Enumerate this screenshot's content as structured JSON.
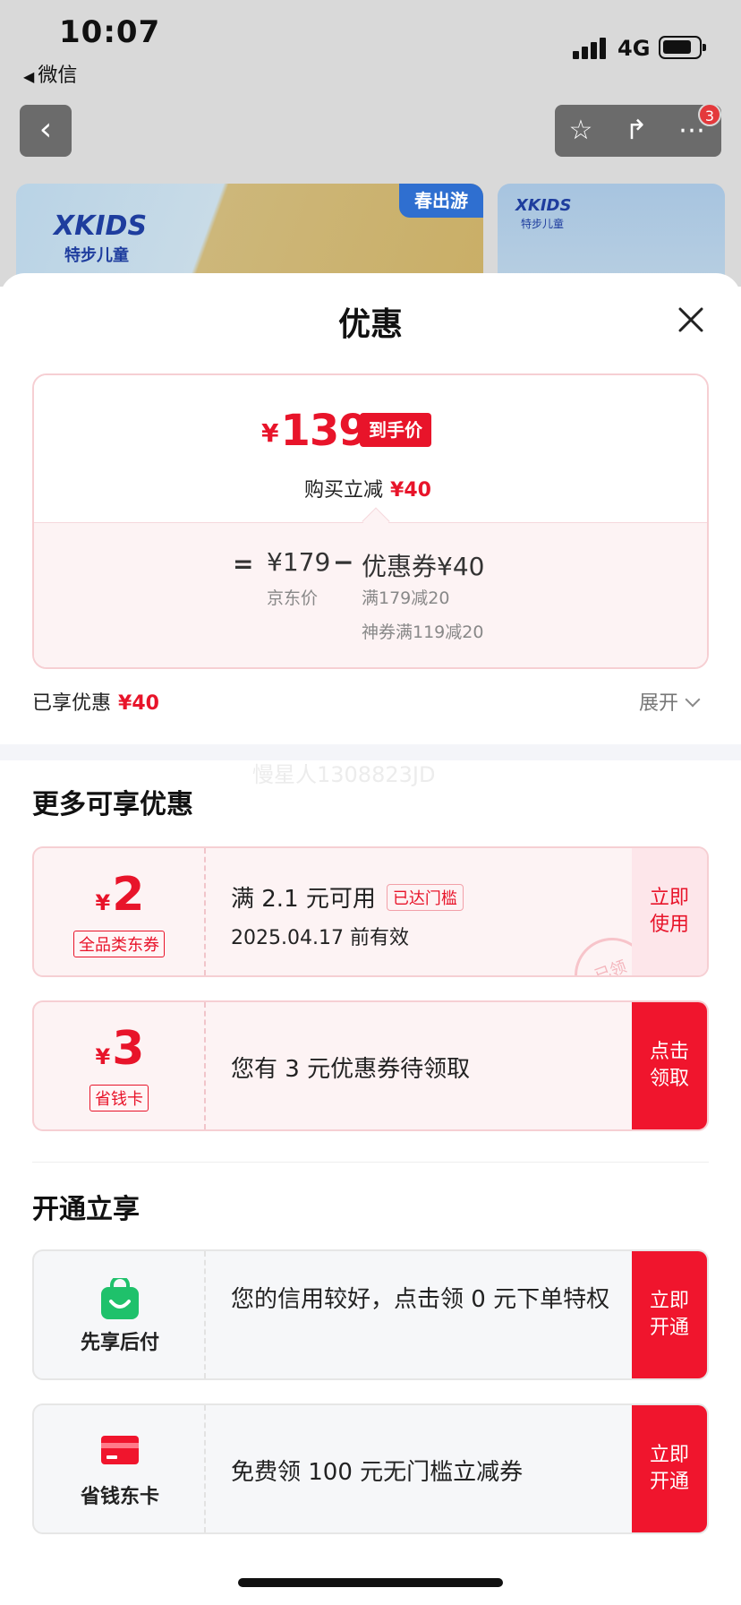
{
  "status_bar": {
    "time": "10:07",
    "back_app": "微信",
    "network": "4G"
  },
  "nav": {
    "badge": "3"
  },
  "banners": {
    "logo": "XKIDS",
    "logo_sub": "特步儿童",
    "tag": "春出游"
  },
  "sheet": {
    "title": "优惠"
  },
  "price_card": {
    "currency": "¥",
    "final_price": "139",
    "final_tag": "到手价",
    "buy_reduce_label": "购买立减",
    "buy_reduce_value": "¥40",
    "equals": "=",
    "jd_price": "¥179",
    "jd_price_label": "京东价",
    "minus": "−",
    "coupon_total": "优惠券¥40",
    "coupon_lines": [
      "满179减20",
      "神券满119减20"
    ]
  },
  "enjoyed": {
    "label": "已享优惠",
    "value": "¥40",
    "expand": "展开"
  },
  "watermark": "慢星人1308823JD",
  "more_section": {
    "title": "更多可享优惠",
    "coupons": [
      {
        "currency": "¥",
        "amount": "2",
        "tag": "全品类东券",
        "line1": "满 2.1 元可用",
        "badge": "已达门槛",
        "line2": "2025.04.17 前有效",
        "action": "立即使用",
        "stamp": "已领"
      },
      {
        "currency": "¥",
        "amount": "3",
        "tag": "省钱卡",
        "line1": "您有 3 元优惠券待领取",
        "action": "点击领取"
      }
    ]
  },
  "open_section": {
    "title": "开通立享",
    "items": [
      {
        "icon": "green-bag-icon",
        "label": "先享后付",
        "text": "您的信用较好，点击领 0 元下单特权",
        "action": "立即开通"
      },
      {
        "icon": "red-card-icon",
        "label": "省钱东卡",
        "text": "免费领 100 元无门槛立减券",
        "action": "立即开通"
      }
    ]
  },
  "colors": {
    "accent": "#e8142a",
    "green": "#1fc16b"
  }
}
